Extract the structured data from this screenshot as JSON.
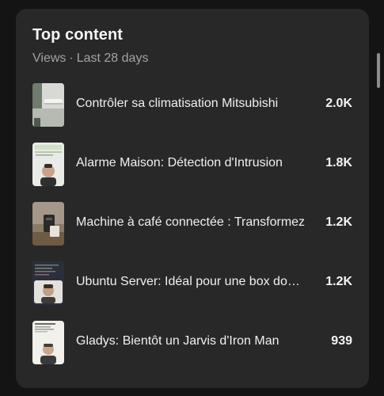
{
  "panel": {
    "title": "Top content",
    "metric": "Views",
    "separator": "·",
    "period": "Last 28 days"
  },
  "items": [
    {
      "title": "Contrôler sa climatisation Mitsubishi",
      "views": "2.0K",
      "thumbnail_icon": "air-conditioner-wall-thumbnail"
    },
    {
      "title": "Alarme Maison: Détection d'Intrusion",
      "views": "1.8K",
      "thumbnail_icon": "presenter-screen-thumbnail"
    },
    {
      "title": "Machine à café connectée : Transformez",
      "views": "1.2K",
      "thumbnail_icon": "coffee-machine-thumbnail"
    },
    {
      "title": "Ubuntu Server: Idéal pour une box domotique",
      "views": "1.2K",
      "thumbnail_icon": "terminal-presenter-thumbnail"
    },
    {
      "title": "Gladys: Bientôt un Jarvis d'Iron Man",
      "views": "939",
      "thumbnail_icon": "slide-presenter-thumbnail"
    }
  ],
  "colors": {
    "background": "#141414",
    "card": "#282828",
    "text_primary": "#f0f0f0",
    "text_secondary": "#a3a3a3"
  }
}
